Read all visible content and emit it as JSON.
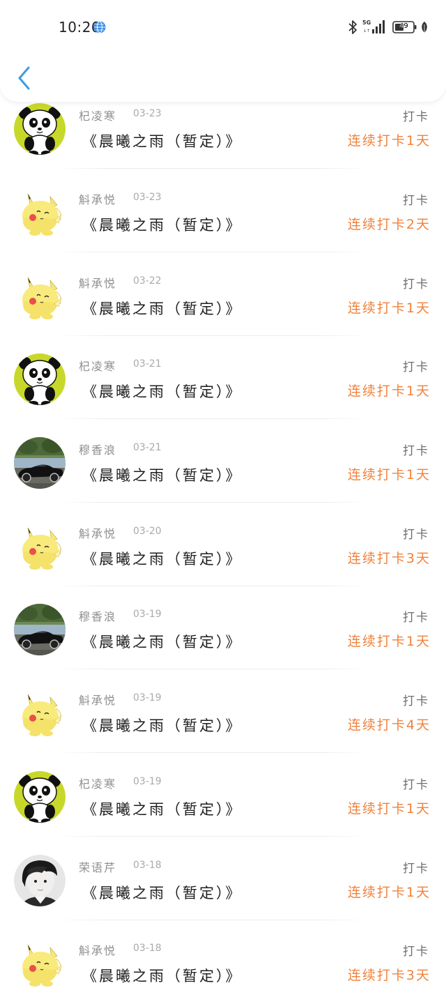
{
  "status_bar": {
    "time": "10:26",
    "network": "5G",
    "battery": "49"
  },
  "colors": {
    "accent_back": "#3d9bdf",
    "streak_orange": "#f0823c"
  },
  "icons": {
    "back": "chevron-left-icon",
    "globe": "globe-icon",
    "bluetooth": "bluetooth-icon",
    "signal": "signal-icon",
    "battery": "battery-icon",
    "leaf": "leaf-icon"
  },
  "entries": [
    {
      "user": "杞凌寒",
      "date": "03-23",
      "book": "《晨曦之雨（暂定）》",
      "action": "打卡",
      "streak": "连续打卡1天",
      "avatar": "panda"
    },
    {
      "user": "斛承悦",
      "date": "03-23",
      "book": "《晨曦之雨（暂定）》",
      "action": "打卡",
      "streak": "连续打卡2天",
      "avatar": "pikachu"
    },
    {
      "user": "斛承悦",
      "date": "03-22",
      "book": "《晨曦之雨（暂定）》",
      "action": "打卡",
      "streak": "连续打卡1天",
      "avatar": "pikachu"
    },
    {
      "user": "杞凌寒",
      "date": "03-21",
      "book": "《晨曦之雨（暂定）》",
      "action": "打卡",
      "streak": "连续打卡1天",
      "avatar": "panda"
    },
    {
      "user": "穆香浪",
      "date": "03-21",
      "book": "《晨曦之雨（暂定）》",
      "action": "打卡",
      "streak": "连续打卡1天",
      "avatar": "car"
    },
    {
      "user": "斛承悦",
      "date": "03-20",
      "book": "《晨曦之雨（暂定）》",
      "action": "打卡",
      "streak": "连续打卡3天",
      "avatar": "pikachu"
    },
    {
      "user": "穆香浪",
      "date": "03-19",
      "book": "《晨曦之雨（暂定）》",
      "action": "打卡",
      "streak": "连续打卡1天",
      "avatar": "car"
    },
    {
      "user": "斛承悦",
      "date": "03-19",
      "book": "《晨曦之雨（暂定）》",
      "action": "打卡",
      "streak": "连续打卡4天",
      "avatar": "pikachu"
    },
    {
      "user": "杞凌寒",
      "date": "03-19",
      "book": "《晨曦之雨（暂定）》",
      "action": "打卡",
      "streak": "连续打卡1天",
      "avatar": "panda"
    },
    {
      "user": "荣语芹",
      "date": "03-18",
      "book": "《晨曦之雨（暂定）》",
      "action": "打卡",
      "streak": "连续打卡1天",
      "avatar": "person"
    },
    {
      "user": "斛承悦",
      "date": "03-18",
      "book": "《晨曦之雨（暂定）》",
      "action": "打卡",
      "streak": "连续打卡3天",
      "avatar": "pikachu"
    }
  ]
}
